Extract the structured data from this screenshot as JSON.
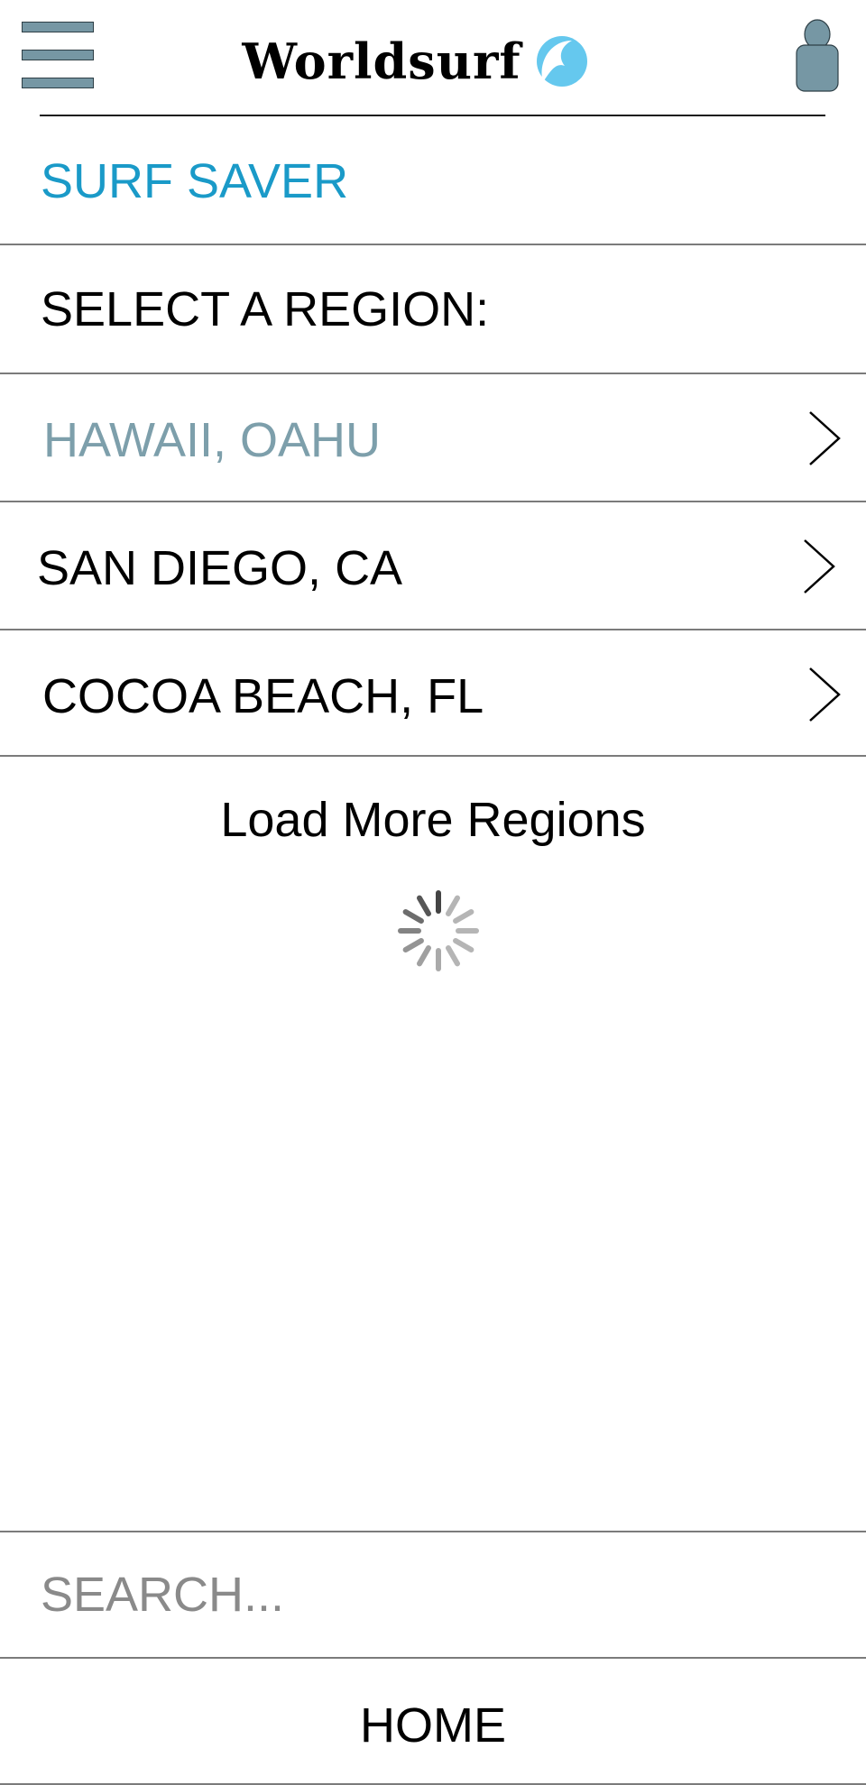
{
  "header": {
    "brand": "Worldsurf",
    "menu_icon": "hamburger-menu-icon",
    "logo_icon": "wave-icon",
    "profile_icon": "user-icon",
    "colors": {
      "logo_wave": "#65c8ee",
      "icon_fill": "#7697a4"
    }
  },
  "page": {
    "title": "SURF SAVER",
    "title_color": "#1a9ac8"
  },
  "regions": {
    "label": "SELECT A REGION:",
    "items": [
      {
        "label": "HAWAII, OAHU",
        "color": "#7d9fab",
        "chevron_icon": "chevron-right-icon"
      },
      {
        "label": "SAN DIEGO, CA",
        "color": "#000000",
        "chevron_icon": "chevron-right-icon"
      },
      {
        "label": "COCOA BEACH, FL",
        "color": "#000000",
        "chevron_icon": "chevron-right-icon"
      }
    ],
    "load_more": "Load More Regions",
    "loading_icon": "loading-spinner-icon"
  },
  "search": {
    "placeholder": "SEARCH...",
    "value": ""
  },
  "footer": {
    "home_label": "HOME"
  }
}
